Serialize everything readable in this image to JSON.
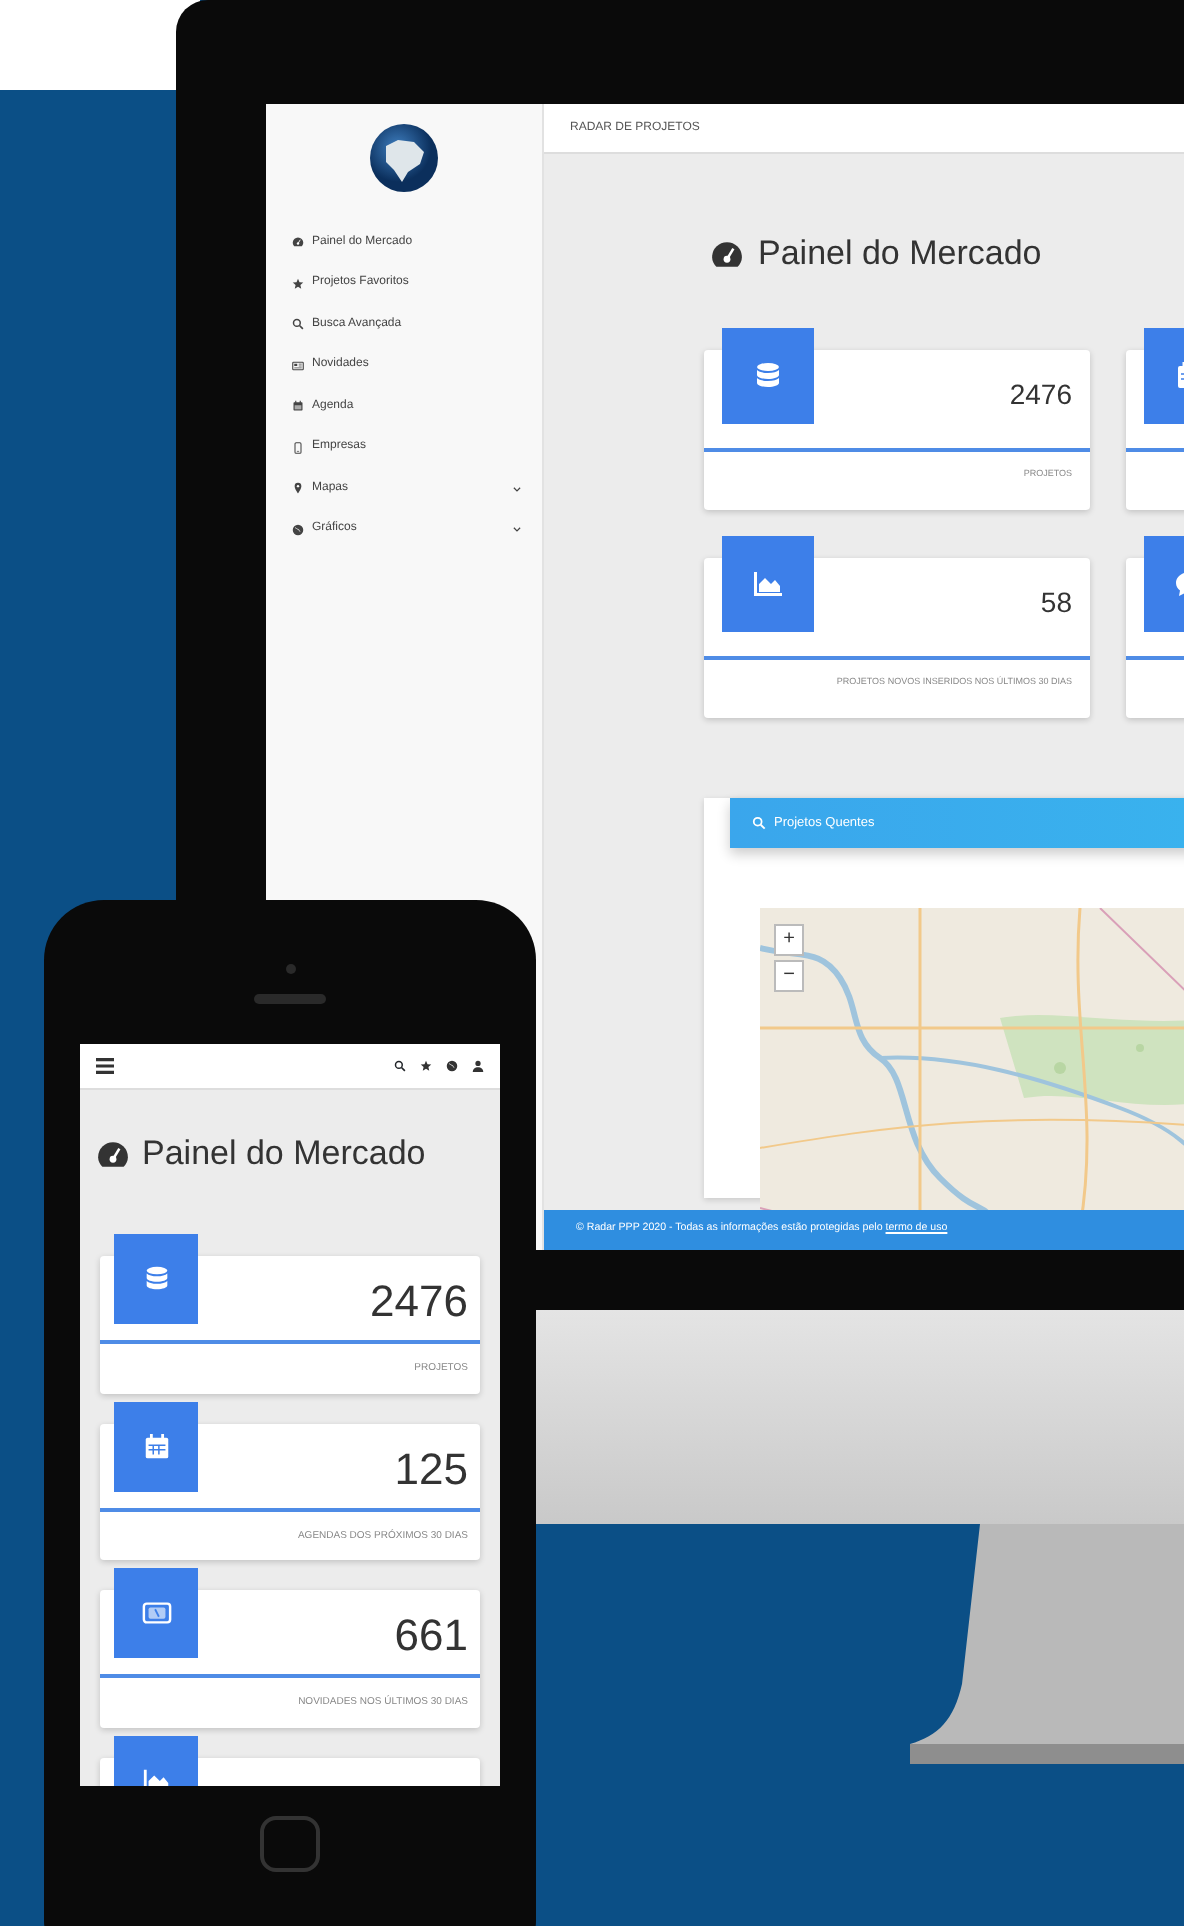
{
  "desktop": {
    "sidebar": {
      "items": [
        {
          "label": "Painel do Mercado",
          "kind": "link"
        },
        {
          "label": "Projetos Favoritos",
          "kind": "link"
        },
        {
          "label": "Busca Avançada",
          "kind": "link"
        },
        {
          "label": "Novidades",
          "kind": "link"
        },
        {
          "label": "Agenda",
          "kind": "link"
        },
        {
          "label": "Empresas",
          "kind": "link"
        },
        {
          "label": "Mapas",
          "kind": "submenu"
        },
        {
          "label": "Gráficos",
          "kind": "submenu"
        }
      ]
    },
    "topbar": {
      "title": "RADAR DE PROJETOS"
    },
    "heading": "Painel do Mercado",
    "cards": [
      {
        "kind": "full",
        "number": "2476",
        "label": "PROJETOS"
      },
      {
        "kind": "cut"
      },
      {
        "kind": "full",
        "number": "58",
        "label": "PROJETOS NOVOS INSERIDOS NOS ÚLTIMOS 30 DIAS"
      },
      {
        "kind": "cut"
      }
    ],
    "panel": {
      "title": "Projetos Quentes",
      "map": {
        "kind": "picture",
        "zoom_in": "+",
        "zoom_out": "−"
      }
    },
    "footer": {
      "text": "© Radar PPP 2020 - Todas as informações estão protegidas pelo ",
      "link": "termo de uso"
    }
  },
  "phone": {
    "heading": "Painel do Mercado",
    "cards": [
      {
        "kind": "full",
        "number": "2476",
        "label": "PROJETOS"
      },
      {
        "kind": "full",
        "number": "125",
        "label": "AGENDAS DOS PRÓXIMOS 30 DIAS"
      },
      {
        "kind": "full",
        "number": "661",
        "label": "NOVIDADES NOS ÚLTIMOS 30 DIAS"
      },
      {
        "kind": "cut"
      }
    ]
  }
}
